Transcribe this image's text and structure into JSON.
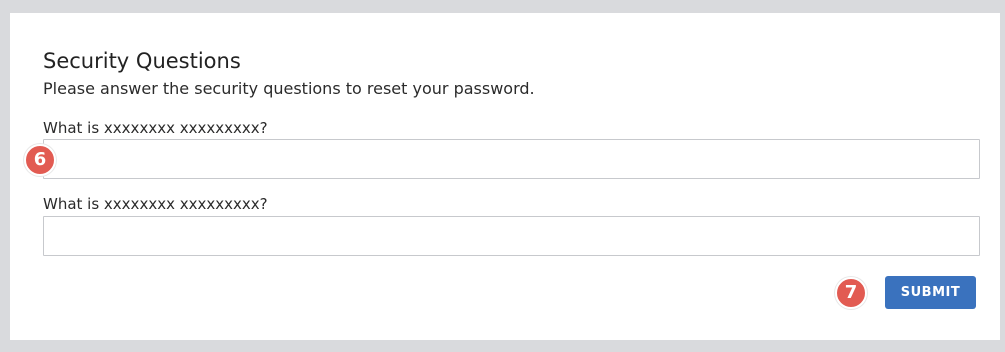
{
  "form": {
    "title": "Security Questions",
    "subtitle": "Please answer the security questions to reset your password.",
    "questions": [
      {
        "label": "What is xxxxxxxx xxxxxxxxx?",
        "value": ""
      },
      {
        "label": "What is xxxxxxxx xxxxxxxxx?",
        "value": ""
      }
    ],
    "submit_label": "SUBMIT"
  },
  "badges": {
    "step_answer": "6",
    "step_submit": "7"
  },
  "colors": {
    "background": "#d9dadd",
    "card": "#ffffff",
    "accent": "#3a72be",
    "badge": "#e25b52"
  }
}
